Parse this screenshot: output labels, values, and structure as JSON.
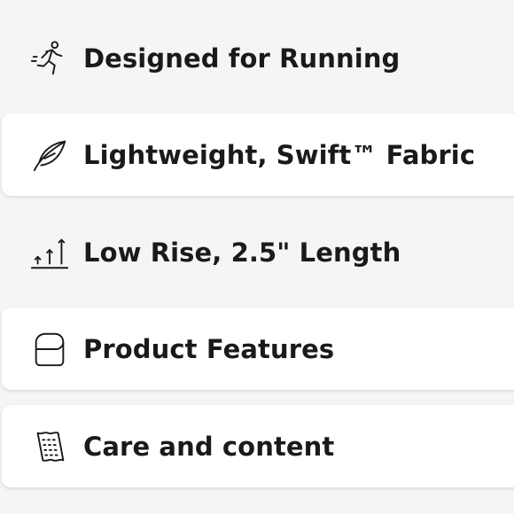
{
  "features": [
    {
      "label": "Designed for Running",
      "icon": "running-person-icon"
    },
    {
      "label": "Lightweight, Swift™ Fabric",
      "icon": "feather-icon"
    },
    {
      "label": "Low Rise, 2.5\" Length",
      "icon": "rise-arrows-icon"
    },
    {
      "label": "Product Features",
      "icon": "pocket-icon"
    },
    {
      "label": "Care and content",
      "icon": "fabric-tag-icon"
    }
  ]
}
